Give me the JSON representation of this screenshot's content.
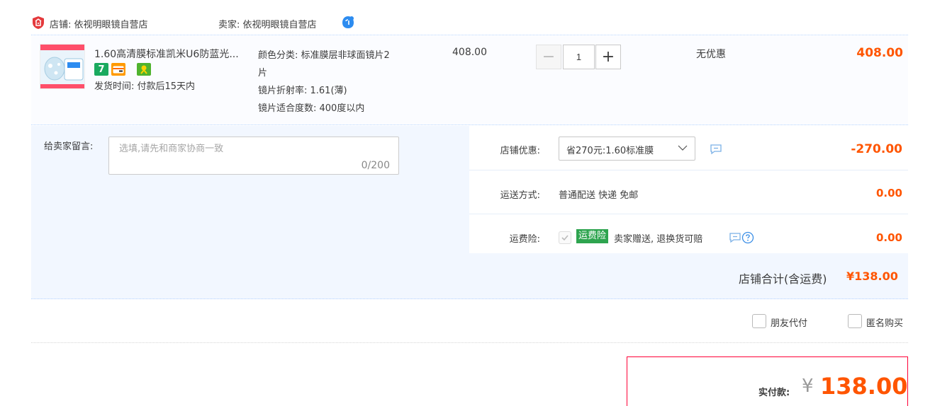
{
  "header": {
    "shop_label": "店铺: 依视明眼镜自营店",
    "seller_label": "卖家: 依视明眼镜自营店",
    "shop_icon": "shield-shop-icon",
    "chat_icon": "wangwang-chat-icon"
  },
  "item": {
    "title": "1.60高清膜标准凯米U6防蓝光...",
    "badges": [
      "7",
      "credit-card",
      "service"
    ],
    "ship_time": "发货时间: 付款后15天内",
    "sku": [
      "颜色分类: 标准膜层非球面镜片2",
      "片",
      "镜片折射率: 1.61(薄)",
      "镜片适合度数: 400度以内"
    ],
    "unit_price": "408.00",
    "quantity": "1",
    "discount": "无优惠",
    "total": "408.00"
  },
  "message": {
    "label": "给卖家留言:",
    "placeholder": "选填,请先和商家协商一致",
    "count": "0/200"
  },
  "coupon": {
    "label": "店铺优惠:",
    "selected": "省270元:1.60标准膜",
    "amount": "-270.00"
  },
  "shipping": {
    "label": "运送方式:",
    "method": "普通配送 快递 免邮",
    "amount": "0.00"
  },
  "insurance": {
    "label": "运费险:",
    "tag": "运费险",
    "text": "卖家赠送, 退换货可赔",
    "amount": "0.00"
  },
  "store_total": {
    "label": "店铺合计(含运费)",
    "value": "¥138.00"
  },
  "options": {
    "friend_pay": "朋友代付",
    "anonymous": "匿名购买"
  },
  "payment": {
    "label": "实付款:",
    "currency": "¥",
    "value": "138.00"
  },
  "colors": {
    "accent": "#ff5500",
    "line": "#b2d1ff",
    "panel_bg": "#f2f7ff"
  }
}
